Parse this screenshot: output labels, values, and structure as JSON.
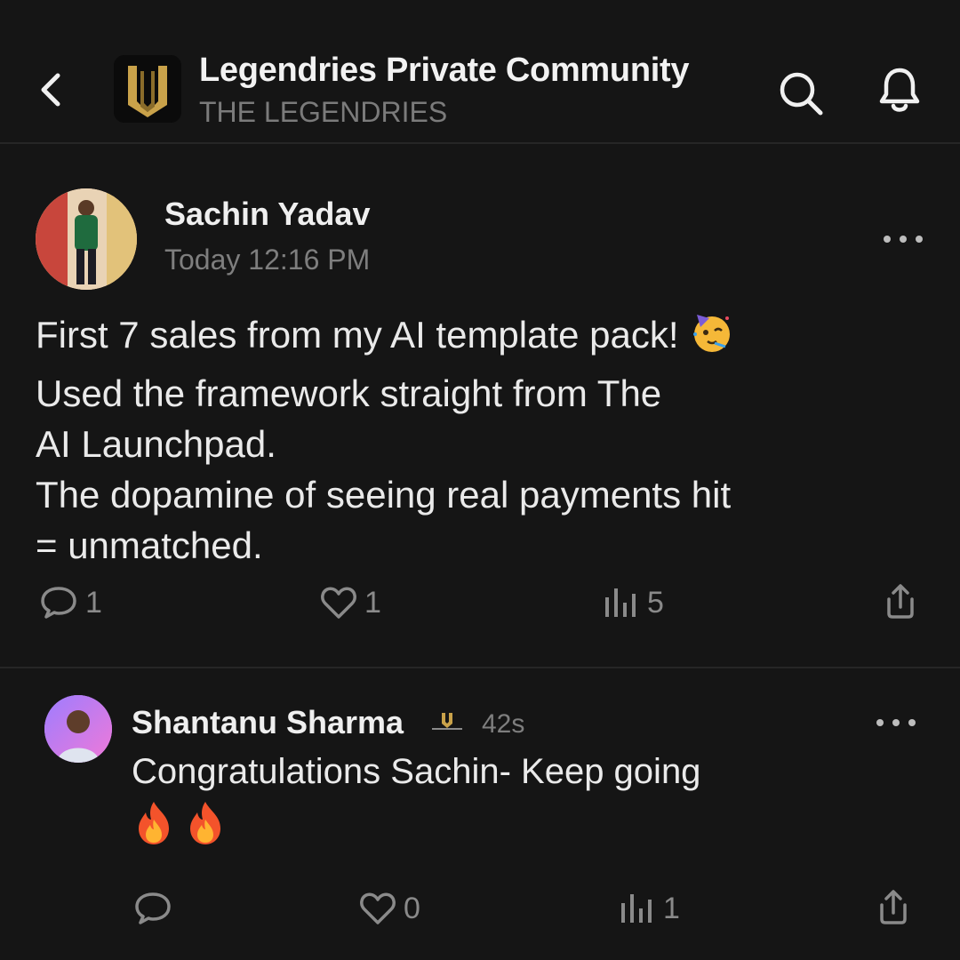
{
  "header": {
    "title": "Legendries Private Community",
    "subtitle": "THE LEGENDRIES",
    "back_icon": "chevron-left-icon",
    "search_icon": "search-icon",
    "bell_icon": "bell-icon",
    "accent_color": "#c9a24a"
  },
  "post": {
    "author": "Sachin Yadav",
    "timestamp": "Today 12:16 PM",
    "lines": [
      "First 7 sales from my AI template pack!",
      "Used the framework straight from The",
      "AI Launchpad.",
      "The dopamine of seeing real payments hit",
      "= unmatched."
    ],
    "emoji_icon": "partying-face-icon",
    "comments_count": "1",
    "likes_count": "1",
    "views_count": "5"
  },
  "comment": {
    "author": "Shantanu Sharma",
    "badge_icon": "legendries-badge-icon",
    "time": "42s",
    "text": "Congratulations Sachin- Keep going",
    "emoji_icons": [
      "fire-icon",
      "fire-icon"
    ],
    "likes_count": "0",
    "views_count": "1"
  },
  "colors": {
    "background": "#151515",
    "divider": "#262626",
    "muted_text": "#7e7e7e",
    "icon_gray": "#8a8a8a"
  }
}
